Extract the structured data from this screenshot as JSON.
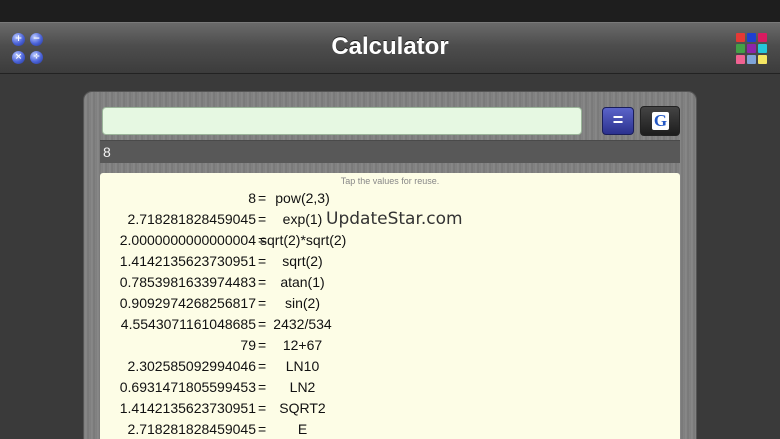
{
  "app": {
    "title": "Calculator"
  },
  "ops_icon": {
    "symbols": [
      "+",
      "−",
      "×",
      "÷"
    ]
  },
  "grid_icon": {
    "colors": [
      "#e53935",
      "#1e3fd0",
      "#d81b60",
      "#43a047",
      "#8e24aa",
      "#26c6da",
      "#f06292",
      "#7fa4d8",
      "#f5e663"
    ]
  },
  "input": {
    "value": "",
    "placeholder": ""
  },
  "buttons": {
    "equals_label": "=",
    "google_label": "G"
  },
  "result": {
    "value": "8"
  },
  "history": {
    "hint": "Tap the values for reuse.",
    "watermark": "UpdateStar.com",
    "rows": [
      {
        "value": "8",
        "eq": "=",
        "expr": "pow(2,3)"
      },
      {
        "value": "2.718281828459045",
        "eq": "=",
        "expr": "exp(1)"
      },
      {
        "value": "2.0000000000000004",
        "eq": "=",
        "expr": "sqrt(2)*sqrt(2)"
      },
      {
        "value": "1.4142135623730951",
        "eq": "=",
        "expr": "sqrt(2)"
      },
      {
        "value": "0.7853981633974483",
        "eq": "=",
        "expr": "atan(1)"
      },
      {
        "value": "0.9092974268256817",
        "eq": "=",
        "expr": "sin(2)"
      },
      {
        "value": "4.5543071161048685",
        "eq": "=",
        "expr": "2432/534"
      },
      {
        "value": "79",
        "eq": "=",
        "expr": "12+67"
      },
      {
        "value": "2.302585092994046",
        "eq": "=",
        "expr": "LN10"
      },
      {
        "value": "0.6931471805599453",
        "eq": "=",
        "expr": "LN2"
      },
      {
        "value": "1.4142135623730951",
        "eq": "=",
        "expr": "SQRT2"
      },
      {
        "value": "2.718281828459045",
        "eq": "=",
        "expr": "E"
      }
    ]
  }
}
